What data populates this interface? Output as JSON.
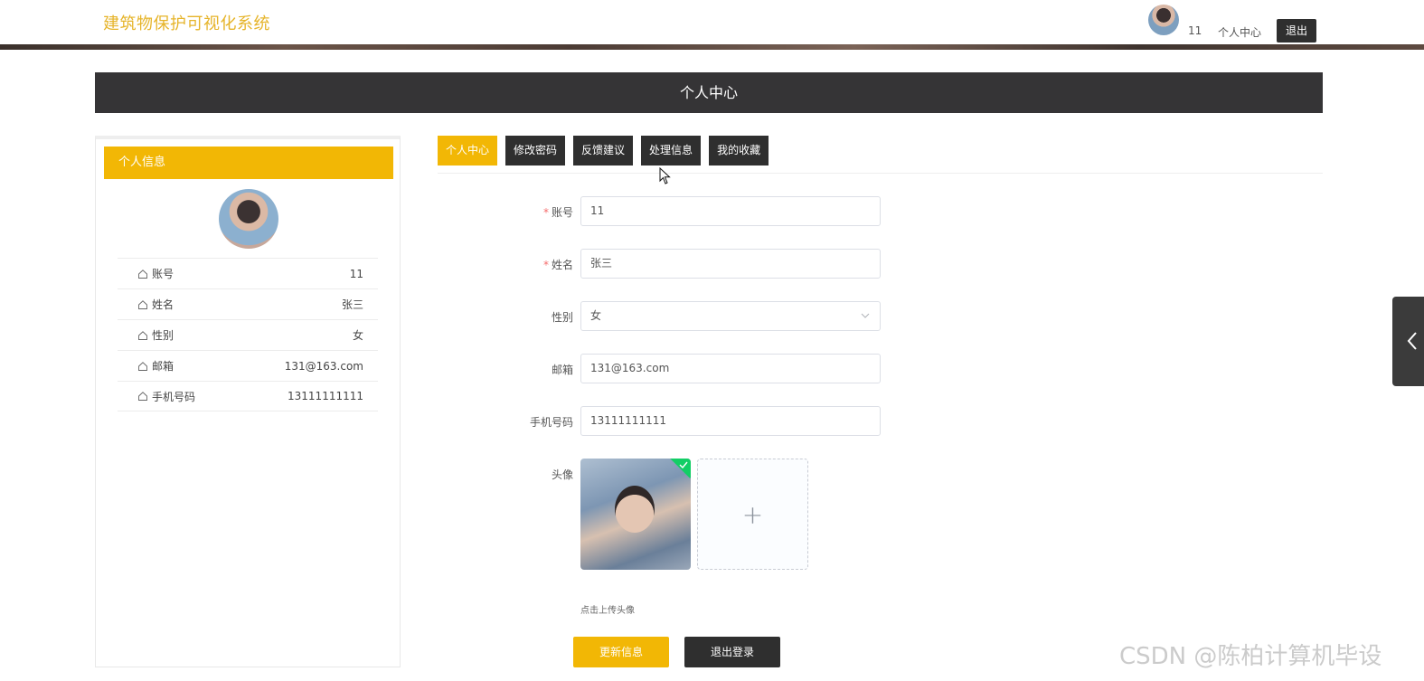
{
  "header": {
    "brand": "建筑物保护可视化系统",
    "user_name": "11",
    "user_center": "个人中心",
    "logout": "退出"
  },
  "title_bar": "个人中心",
  "profile_panel": {
    "title": "个人信息",
    "rows": [
      {
        "label": "账号",
        "value": "11"
      },
      {
        "label": "姓名",
        "value": "张三"
      },
      {
        "label": "性别",
        "value": "女"
      },
      {
        "label": "邮箱",
        "value": "131@163.com"
      },
      {
        "label": "手机号码",
        "value": "13111111111"
      }
    ]
  },
  "tabs": [
    {
      "label": "个人中心",
      "active": true
    },
    {
      "label": "修改密码",
      "active": false
    },
    {
      "label": "反馈建议",
      "active": false
    },
    {
      "label": "处理信息",
      "active": false
    },
    {
      "label": "我的收藏",
      "active": false
    }
  ],
  "form": {
    "account": {
      "label": "账号",
      "value": "11",
      "required": "*"
    },
    "name": {
      "label": "姓名",
      "value": "张三",
      "required": "*"
    },
    "gender": {
      "label": "性别",
      "value": "女"
    },
    "email": {
      "label": "邮箱",
      "value": "131@163.com"
    },
    "phone": {
      "label": "手机号码",
      "value": "13111111111"
    },
    "avatar": {
      "label": "头像",
      "hint": "点击上传头像",
      "plus": "+"
    },
    "update_button": "更新信息",
    "logout_button": "退出登录"
  },
  "watermark": "CSDN @陈柏计算机毕设",
  "colors": {
    "accent": "#f2b705",
    "dark": "#2f2f2f",
    "brand_text": "#e6b42a"
  }
}
